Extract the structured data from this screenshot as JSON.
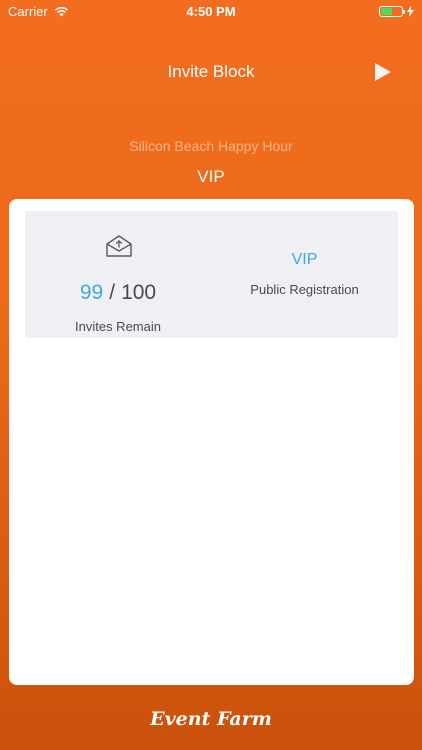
{
  "status_bar": {
    "carrier": "Carrier",
    "time": "4:50 PM",
    "battery_level": 0.55,
    "battery_color": "#4cd964"
  },
  "nav": {
    "title": "Invite Block",
    "action_icon": "play-icon"
  },
  "event": {
    "name": "Silicon Beach Happy Hour",
    "block_name": "VIP"
  },
  "invites": {
    "icon": "envelope-open-icon",
    "remaining": "99",
    "separator": "/",
    "total": "100",
    "label": "Invites Remain"
  },
  "ticket_type": {
    "name": "VIP",
    "label": "Public Registration"
  },
  "footer": {
    "logo_text": "Event Farm"
  },
  "colors": {
    "accent": "#3fa9e0",
    "brand_orange": "#f26d1f",
    "panel_bg": "#eff0f3"
  }
}
